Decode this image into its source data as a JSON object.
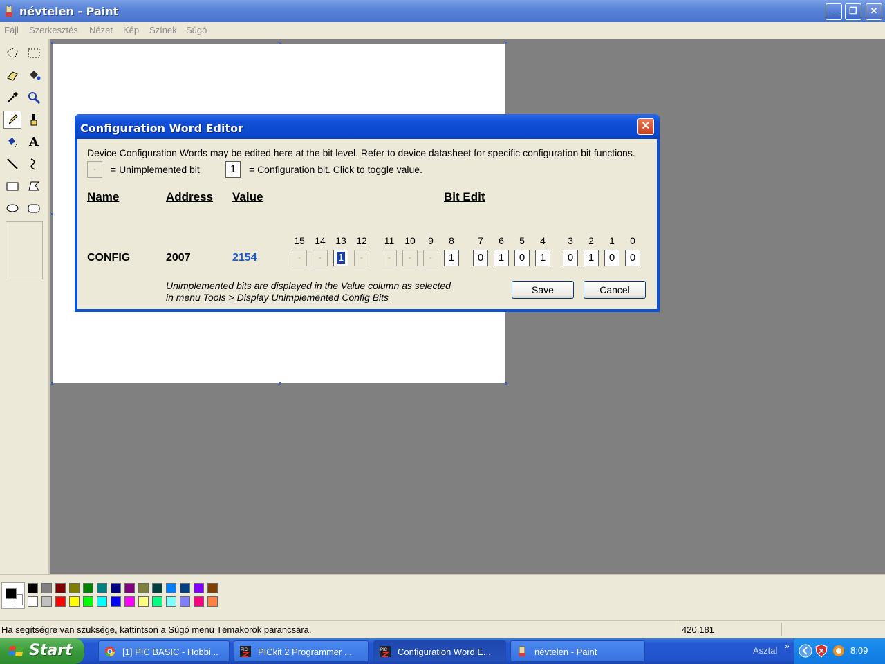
{
  "paint": {
    "title": "névtelen - Paint",
    "menu": [
      "Fájl",
      "Szerkesztés",
      "Nézet",
      "Kép",
      "Színek",
      "Súgó"
    ],
    "window_buttons": {
      "minimize": "_",
      "maximize": "❐",
      "close": "✕"
    },
    "status_text": "Ha segítségre van szüksége, kattintson a Súgó menü Témakörök parancsára.",
    "coords": "420,181",
    "palette_top": [
      "#000000",
      "#808080",
      "#800000",
      "#808000",
      "#008000",
      "#008080",
      "#000080",
      "#800080",
      "#808040",
      "#004040",
      "#0080ff",
      "#004080",
      "#8000ff",
      "#804000"
    ],
    "palette_bottom": [
      "#ffffff",
      "#c0c0c0",
      "#ff0000",
      "#ffff00",
      "#00ff00",
      "#00ffff",
      "#0000ff",
      "#ff00ff",
      "#ffff80",
      "#00ff80",
      "#80ffff",
      "#8080ff",
      "#ff0080",
      "#ff8040"
    ],
    "tools": [
      "free-select",
      "rect-select",
      "eraser",
      "fill",
      "color-picker",
      "magnifier",
      "pencil",
      "brush",
      "airbrush",
      "text",
      "line",
      "curve",
      "rectangle",
      "polygon",
      "ellipse",
      "rounded-rectangle"
    ]
  },
  "dialog": {
    "title": "Configuration Word Editor",
    "close": "✕",
    "description": "Device Configuration Words may be edited here at the bit level.  Refer to device datasheet for specific configuration bit functions.",
    "legend_unimp_sample": "-",
    "legend_unimp": "= Unimplemented bit",
    "legend_config_sample": "1",
    "legend_config": "= Configuration bit.  Click to toggle value.",
    "headers": {
      "name": "Name",
      "address": "Address",
      "value": "Value",
      "bit_edit": "Bit Edit"
    },
    "row": {
      "name": "CONFIG",
      "address": "2007",
      "value": "2154"
    },
    "bit_numbers": [
      "15",
      "14",
      "13",
      "12",
      "11",
      "10",
      "9",
      "8",
      "7",
      "6",
      "5",
      "4",
      "3",
      "2",
      "1",
      "0"
    ],
    "bits": [
      "-",
      "-",
      "1",
      "-",
      "-",
      "-",
      "-",
      "1",
      "0",
      "1",
      "0",
      "1",
      "0",
      "1",
      "0",
      "0"
    ],
    "note_line1": "Unimplemented bits are displayed in the Value column as selected",
    "note_line2_prefix": "in menu ",
    "note_line2_link": "Tools > Display Unimplemented Config Bits",
    "save": "Save",
    "cancel": "Cancel"
  },
  "taskbar": {
    "start": "Start",
    "tasks": [
      {
        "label": "[1] PIC BASIC - Hobbi...",
        "icon": "chrome-icon",
        "active": false
      },
      {
        "label": "PICkit 2 Programmer ...",
        "icon": "pickit-icon",
        "active": false
      },
      {
        "label": "Configuration Word E...",
        "icon": "pickit-icon",
        "active": true
      },
      {
        "label": "névtelen - Paint",
        "icon": "paint-icon",
        "active": false
      }
    ],
    "desktop": "Asztal",
    "chevron": "»",
    "clock": "8:09"
  },
  "colors": {
    "dialog_value": "#1a5ad0",
    "title_blue": "#0a52d8"
  }
}
